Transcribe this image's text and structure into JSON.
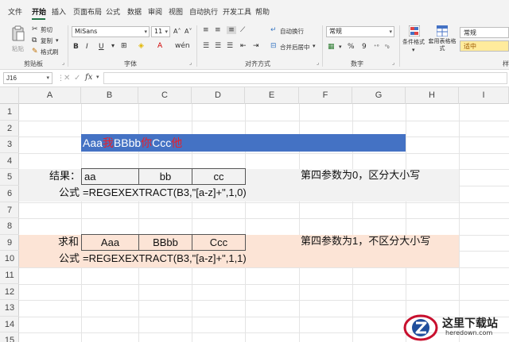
{
  "menu": {
    "items": [
      "文件",
      "开始",
      "插入",
      "页面布局",
      "公式",
      "数据",
      "审阅",
      "视图",
      "自动执行",
      "开发工具",
      "帮助"
    ],
    "active": "开始"
  },
  "ribbon": {
    "clipboard": {
      "paste": "粘贴",
      "cut": "剪切",
      "copy": "复制",
      "format_painter": "格式刷",
      "label": "剪贴板"
    },
    "font": {
      "name": "MiSans",
      "size": "11",
      "label": "字体"
    },
    "alignment": {
      "wrap": "自动换行",
      "merge": "合并后居中",
      "label": "对齐方式"
    },
    "number": {
      "format": "常规",
      "percent": "%",
      "comma": "9",
      "label": "数字"
    },
    "styles": {
      "conditional": "条件格式",
      "table": "套用表格格式",
      "normal": "常规",
      "neutral": "适中",
      "label": "样"
    }
  },
  "formula_bar": {
    "name_box": "J16",
    "fx": "fx",
    "content": ""
  },
  "sheet": {
    "columns": [
      "A",
      "B",
      "C",
      "D",
      "E",
      "F",
      "G",
      "H",
      "I"
    ],
    "rows": [
      "1",
      "2",
      "3",
      "4",
      "5",
      "6",
      "7",
      "8",
      "9",
      "10",
      "11",
      "12",
      "13",
      "14",
      "15"
    ],
    "title_parts": [
      {
        "text": "Aaa",
        "color": "white"
      },
      {
        "text": "我",
        "color": "red"
      },
      {
        "text": "BBbb",
        "color": "white"
      },
      {
        "text": "你",
        "color": "red"
      },
      {
        "text": "Ccc",
        "color": "white"
      },
      {
        "text": "他",
        "color": "red"
      }
    ],
    "block1": {
      "label": "结果：",
      "values": [
        "aa",
        "bb",
        "cc"
      ],
      "formula_label": "公式",
      "formula": "=REGEXEXTRACT(B3,\"[a-z]+\",1,0)",
      "note": "第四参数为0，区分大小写",
      "bg": "#f2f2f2"
    },
    "block2": {
      "label": "求和",
      "values": [
        "Aaa",
        "BBbb",
        "Ccc"
      ],
      "formula_label": "公式",
      "formula": "=REGEXEXTRACT(B3,\"[a-z]+\",1,1)",
      "note": "第四参数为1，不区分大小写",
      "bg": "#fce4d6"
    },
    "title_bg": "#4472c4"
  },
  "watermark": {
    "main": "这里下载站",
    "sub": "heredown.com"
  }
}
